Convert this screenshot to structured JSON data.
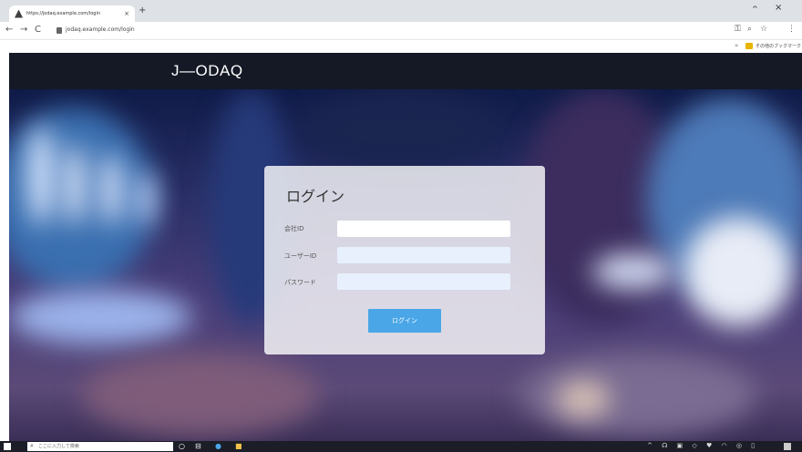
{
  "browser": {
    "tab_title": "https://jodaq.example.com/login",
    "tab_close": "×",
    "new_tab": "+",
    "url": "jodaq.example.com/login",
    "back": "←",
    "forward": "→",
    "reload": "C",
    "minimize": "ᴖ",
    "close": "×",
    "bookmark_label": "その他のブックマーク"
  },
  "site": {
    "logo": "J—ODAQ"
  },
  "login": {
    "title": "ログイン",
    "fields": [
      {
        "label": "会社ID",
        "value": ""
      },
      {
        "label": "ユーザーID",
        "value": ""
      },
      {
        "label": "パスワード",
        "value": ""
      }
    ],
    "button": "ログイン"
  },
  "taskbar": {
    "search_placeholder": "ここに入力して検索"
  },
  "colors": {
    "header": "#151926",
    "accent": "#4aa6e6"
  }
}
